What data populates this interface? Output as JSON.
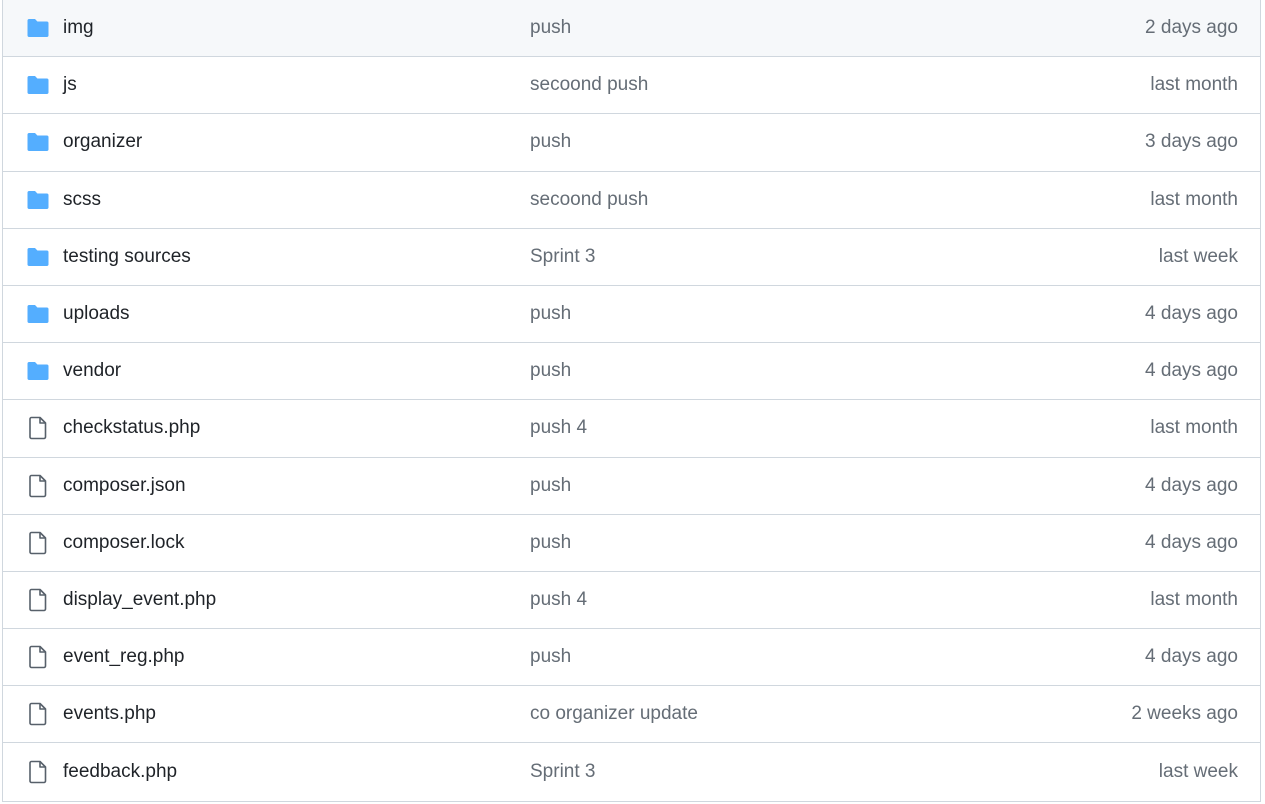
{
  "files": [
    {
      "type": "folder",
      "icon": "folder-icon",
      "name": "img",
      "message": "push",
      "age": "2 days ago"
    },
    {
      "type": "folder",
      "icon": "folder-icon",
      "name": "js",
      "message": "secoond push",
      "age": "last month"
    },
    {
      "type": "folder",
      "icon": "folder-icon",
      "name": "organizer",
      "message": "push",
      "age": "3 days ago"
    },
    {
      "type": "folder",
      "icon": "folder-icon",
      "name": "scss",
      "message": "secoond push",
      "age": "last month"
    },
    {
      "type": "folder",
      "icon": "folder-icon",
      "name": "testing sources",
      "message": "Sprint 3",
      "age": "last week"
    },
    {
      "type": "folder",
      "icon": "folder-icon",
      "name": "uploads",
      "message": "push",
      "age": "4 days ago"
    },
    {
      "type": "folder",
      "icon": "folder-icon",
      "name": "vendor",
      "message": "push",
      "age": "4 days ago"
    },
    {
      "type": "file",
      "icon": "file-icon",
      "name": "checkstatus.php",
      "message": "push 4",
      "age": "last month"
    },
    {
      "type": "file",
      "icon": "file-icon",
      "name": "composer.json",
      "message": "push",
      "age": "4 days ago"
    },
    {
      "type": "file",
      "icon": "file-icon",
      "name": "composer.lock",
      "message": "push",
      "age": "4 days ago"
    },
    {
      "type": "file",
      "icon": "file-icon",
      "name": "display_event.php",
      "message": "push 4",
      "age": "last month"
    },
    {
      "type": "file",
      "icon": "file-icon",
      "name": "event_reg.php",
      "message": "push",
      "age": "4 days ago"
    },
    {
      "type": "file",
      "icon": "file-icon",
      "name": "events.php",
      "message": "co organizer update",
      "age": "2 weeks ago"
    },
    {
      "type": "file",
      "icon": "file-icon",
      "name": "feedback.php",
      "message": "Sprint 3",
      "age": "last week"
    }
  ],
  "colors": {
    "folder": "#54aeff",
    "file_outline": "#57606a",
    "text_primary": "#1f2328",
    "text_secondary": "#656d76",
    "border": "#d0d7de",
    "hover_row": "#f6f8fa"
  }
}
